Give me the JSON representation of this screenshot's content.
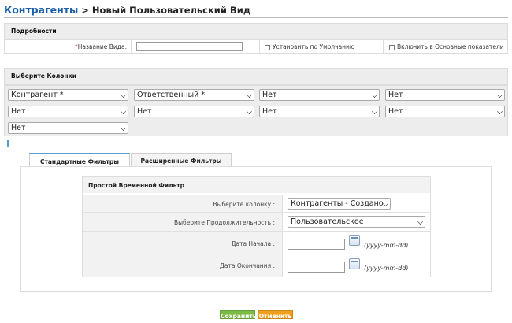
{
  "header": {
    "module": "Контрагенты",
    "separator": " > ",
    "page": "Новый Пользовательский Вид"
  },
  "details": {
    "section_title": "Подробности",
    "name_label": "Название Вида:",
    "name_value": "",
    "default_label": "Установить по Умолчанию",
    "default_checked": false,
    "metrics_label": "Включить в Основные показатели",
    "metrics_checked": false
  },
  "columns": {
    "section_title": "Выберите Колонки",
    "selects": [
      "Контрагент *",
      "Ответственный *",
      "Нет",
      "Нет",
      "Нет",
      "Нет",
      "Нет",
      "Нет",
      "Нет"
    ]
  },
  "tabs": [
    {
      "label": "Стандартные Фильтры"
    },
    {
      "label": "Расширенные Фильтры"
    }
  ],
  "date_filter": {
    "title": "Простой Временной Фильтр",
    "column_label": "Выберите колонку :",
    "column_value": "Контрагенты - Создано",
    "duration_label": "Выберите Продолжительность :",
    "duration_value": "Пользовательское",
    "start_label": "Дата Начала :",
    "start_value": "",
    "end_label": "Дата Окончания :",
    "end_value": "",
    "date_format": "(yyyy-mm-dd)"
  },
  "buttons": {
    "save": "Сохранить",
    "cancel": "Отменить"
  },
  "colors": {
    "link": "#1a5fa8",
    "save_button": "#7cbb45",
    "cancel_button": "#f0a01d",
    "active_tab_border": "#5b9bd5"
  }
}
